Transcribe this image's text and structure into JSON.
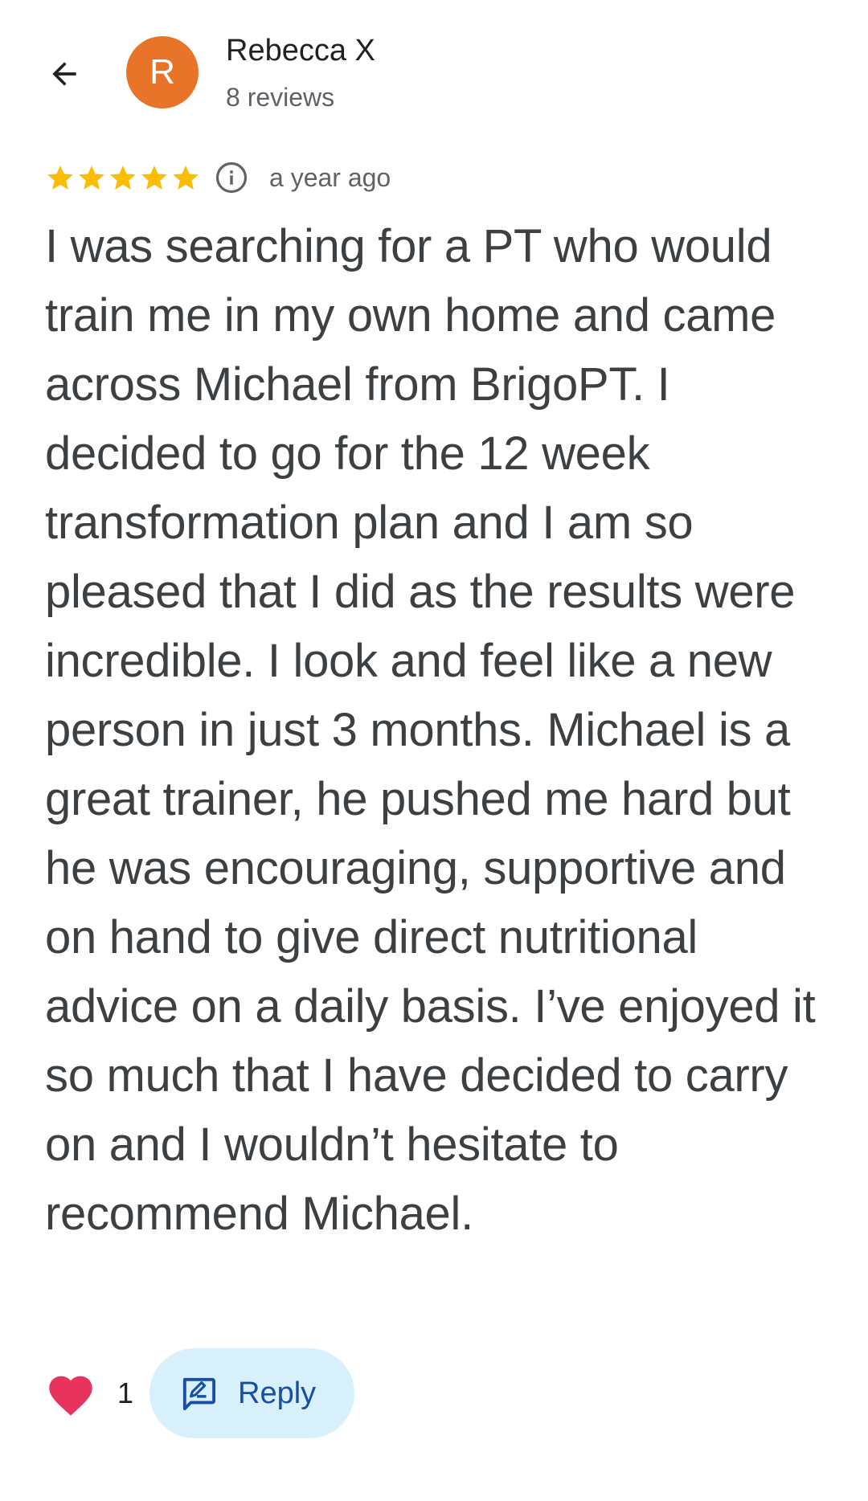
{
  "colors": {
    "avatar_bg": "#e8742a",
    "star": "#fbbc04",
    "heart": "#e8345c",
    "reply_bg": "#d8f0fb",
    "reply_text": "#174ea6"
  },
  "header": {
    "back_icon": "arrow-back-icon",
    "avatar_letter": "R",
    "author_name": "Rebecca X",
    "review_count": "8 reviews"
  },
  "review": {
    "rating": 5,
    "rating_max": 5,
    "info_icon": "info-icon",
    "date": "a year ago",
    "text": "I was searching for a PT who would train me in my own home and came across Michael from BrigoPT. I decided to go for the 12 week transformation plan and I am so pleased that I did as the results were incredible. I look and feel like a new person in just 3 months. Michael is a great trainer, he pushed me hard but he was encouraging, supportive and on hand to give direct nutritional advice on a daily basis. I’ve enjoyed it so much that I have decided to carry on and I wouldn’t hesitate to recommend Michael."
  },
  "actions": {
    "like_icon": "heart-icon",
    "like_count": "1",
    "reply_icon": "reply-icon",
    "reply_label": "Reply"
  }
}
